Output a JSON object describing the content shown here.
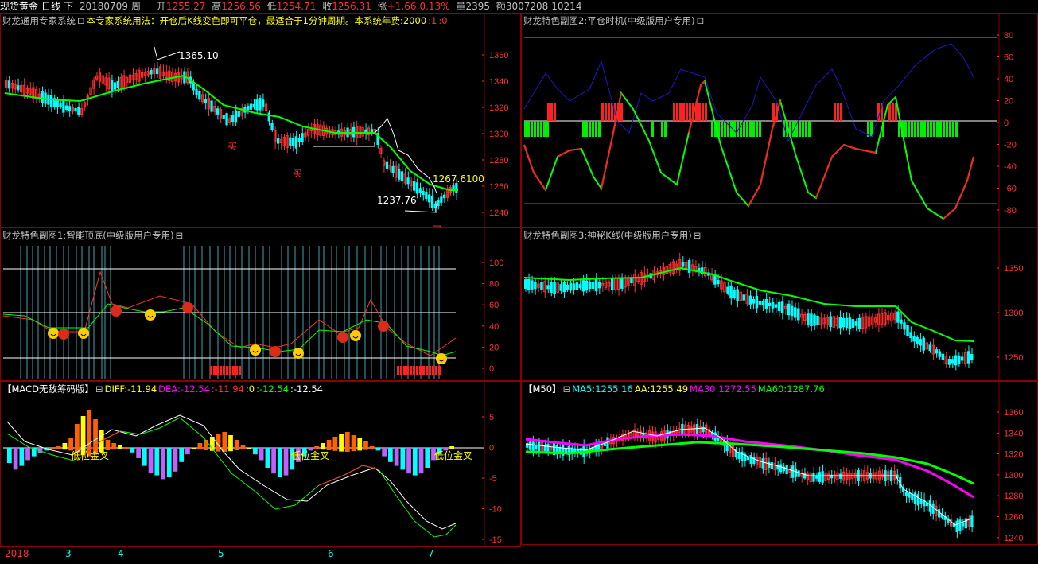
{
  "header": {
    "instrument": "现货黄金",
    "period": "日线",
    "mode": "下",
    "date": "20180709",
    "weekday": "周一",
    "open_label": "开",
    "open": "1255.27",
    "high_label": "高",
    "high": "1256.56",
    "low_label": "低",
    "low": "1254.71",
    "close_label": "收",
    "close": "1256.31",
    "change_label": "涨",
    "change": "+1.66",
    "change_pct": "0.13%",
    "volume_label": "量",
    "volume": "2395",
    "amount_label": "额",
    "amount": "3007208",
    "extra": "10214"
  },
  "colors": {
    "up": "#ff3030",
    "down": "#00ffff",
    "border": "#8b0000",
    "axis": "#ff3030",
    "green": "#00ff00",
    "yellow": "#ffff00",
    "magenta": "#ff00ff",
    "white": "#ffffff",
    "blue": "#1818c8"
  },
  "main": {
    "title": "财龙通用专家系统",
    "title_icon": "collapse-icon",
    "usage": "本专家系统用法：开仓后K线变色即可平仓，最适合于1分钟周期。本系统年费:2000",
    "param1": ":1",
    "param2": ":0",
    "high_label": "1365.10",
    "low_label": "1237.76",
    "last_label": "1267.6100",
    "signal_labels": [
      "买",
      "买",
      "买"
    ],
    "y_ticks": [
      "1360",
      "1340",
      "1320",
      "1300",
      "1280",
      "1260",
      "1240"
    ]
  },
  "sub2": {
    "title": "财龙特色副图2:平仓时机(中级版用户专用)",
    "y_ticks": [
      "80",
      "60",
      "40",
      "20",
      "0",
      "-20",
      "-40",
      "-60",
      "-80"
    ]
  },
  "sub1": {
    "title": "财龙特色副图1:智能顶底(中级版用户专用)",
    "y_ticks": [
      "100",
      "80",
      "60",
      "40",
      "20",
      "0"
    ]
  },
  "sub3": {
    "title": "财龙特色副图3:神秘K线(中级版用户专用)",
    "y_ticks": [
      "1350",
      "1300",
      "1250"
    ]
  },
  "macd": {
    "title": "【MACD无敌筹码版】",
    "diff_label": "DIFF:",
    "diff": "-11.94",
    "dea_label": "DEA:",
    "dea": "-12.54",
    "p1": ":-11.94",
    "p2": ":0",
    "p3": ":-12.54",
    "p4": ":-12.54",
    "cross_labels": [
      "低位金叉",
      "低位金叉",
      "低位金叉"
    ],
    "y_ticks": [
      "5",
      "0",
      "-5",
      "-10",
      "-15"
    ]
  },
  "ma": {
    "title": "【M50】",
    "ma5_label": "MA5:",
    "ma5": "1255.16",
    "aa_label": "AA:",
    "aa": "1255.49",
    "ma30_label": "MA30:",
    "ma30": "1272.55",
    "ma60_label": "MA60:",
    "ma60": "1287.76",
    "y_ticks": [
      "1360",
      "1340",
      "1320",
      "1300",
      "1280",
      "1260",
      "1240"
    ]
  },
  "xaxis": {
    "year": "2018",
    "months": [
      "3",
      "4",
      "5",
      "6",
      "7"
    ]
  }
}
